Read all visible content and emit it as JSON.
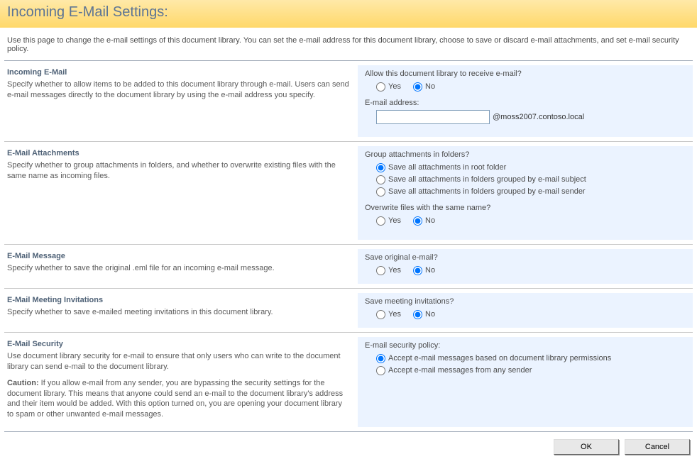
{
  "header": {
    "title": "Incoming E-Mail Settings:"
  },
  "intro": "Use this page to change the e-mail settings of this document library. You can set the e-mail address for this document library, choose to save or discard e-mail attachments, and set e-mail security policy.",
  "sections": {
    "incoming": {
      "title": "Incoming E-Mail",
      "desc": "Specify whether to allow items to be added to this document library through e-mail. Users can send e-mail messages directly to the document library by using the e-mail address you specify.",
      "allow_label": "Allow this document library to receive e-mail?",
      "yes": "Yes",
      "no": "No",
      "address_label": "E-mail address:",
      "address_value": "",
      "domain": "@moss2007.contoso.local"
    },
    "attachments": {
      "title": "E-Mail Attachments",
      "desc": "Specify whether to group attachments in folders, and whether to overwrite existing files with the same name as incoming files.",
      "group_label": "Group attachments in folders?",
      "opt_root": "Save all attachments in root folder",
      "opt_subject": "Save all attachments in folders grouped by e-mail subject",
      "opt_sender": "Save all attachments in folders grouped by e-mail sender",
      "overwrite_label": "Overwrite files with the same name?",
      "yes": "Yes",
      "no": "No"
    },
    "message": {
      "title": "E-Mail Message",
      "desc": "Specify whether to save the original .eml file for an incoming e-mail message.",
      "save_label": "Save original e-mail?",
      "yes": "Yes",
      "no": "No"
    },
    "meeting": {
      "title": "E-Mail Meeting Invitations",
      "desc": "Specify whether to save e-mailed meeting invitations in this document library.",
      "save_label": "Save meeting invitations?",
      "yes": "Yes",
      "no": "No"
    },
    "security": {
      "title": "E-Mail Security",
      "desc": "Use document library security for e-mail to ensure that only users who can write to the document library can send e-mail to the document library.",
      "caution_strong": "Caution:",
      "caution_text": " If you allow e-mail from any sender, you are bypassing the security settings for the document library. This means that anyone could send an e-mail to the document library's address and their item would be added. With this option turned on, you are opening your document library to spam or other unwanted e-mail messages.",
      "policy_label": "E-mail security policy:",
      "opt_perm": "Accept e-mail messages based on document library permissions",
      "opt_any": "Accept e-mail messages from any sender"
    }
  },
  "buttons": {
    "ok": "OK",
    "cancel": "Cancel"
  }
}
